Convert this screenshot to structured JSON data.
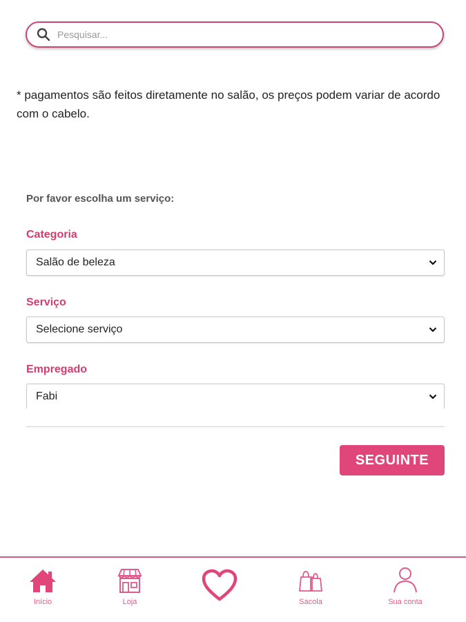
{
  "search": {
    "placeholder": "Pesquisar..."
  },
  "note": "* pagamentos são feitos diretamente no salão, os preços podem variar de acordo com o cabelo.",
  "form": {
    "prompt": "Por favor escolha um serviço:",
    "category": {
      "label": "Categoria",
      "value": "Salão de beleza"
    },
    "service": {
      "label": "Serviço",
      "value": "Selecione serviço"
    },
    "employee": {
      "label": "Empregado",
      "value": "Fabi"
    },
    "next_label": "SEGUINTE"
  },
  "bottom_nav": {
    "items": [
      {
        "label": "Início",
        "icon": "home-icon"
      },
      {
        "label": "Loja",
        "icon": "store-icon"
      },
      {
        "label": "",
        "icon": "heart-icon"
      },
      {
        "label": "Sacola",
        "icon": "bag-icon"
      },
      {
        "label": "Sua conta",
        "icon": "user-icon"
      }
    ]
  },
  "colors": {
    "accent": "#e0467a",
    "label": "#d63c6e",
    "nav": "#e05a8c"
  }
}
